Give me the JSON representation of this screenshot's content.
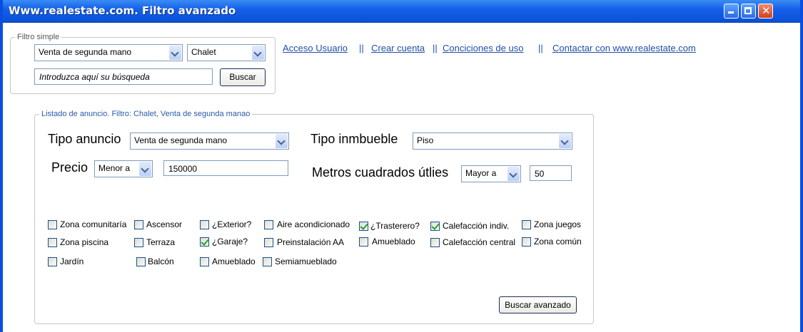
{
  "window": {
    "title": "Www.realestate.com. Filtro avanzado"
  },
  "simple_filter": {
    "legend": "Filtro simple",
    "operation_select": "Venta de segunda mano",
    "property_select": "Chalet",
    "search_placeholder": "Introduzca aquí su búsqueda",
    "search_button": "Buscar"
  },
  "links": {
    "login": "Acceso Usuario",
    "sep1": "||",
    "create_account": "Crear cuenta",
    "sep2": "||",
    "terms": "Conciciones de uso",
    "sep3": "||",
    "contact": "Contactar con www.realestate.com"
  },
  "listing": {
    "legend": "Listado de anuncio. Filtro: Chalet, Venta de segunda manao",
    "tipo_anuncio_label": "Tipo anuncio",
    "tipo_anuncio_value": "Venta de segunda mano",
    "tipo_inmueble_label": "Tipo inmbueble",
    "tipo_inmueble_value": "Piso",
    "precio_label": "Precio",
    "precio_op": "Menor a",
    "precio_value": "150000",
    "metros_label": "Metros cuadrados útlies",
    "metros_op": "Mayor a",
    "metros_value": "50",
    "features": [
      {
        "label": "Zona comunitaría",
        "checked": false
      },
      {
        "label": "Ascensor",
        "checked": false
      },
      {
        "label": "¿Exterior?",
        "checked": false
      },
      {
        "label": "Aire acondicionado",
        "checked": false
      },
      {
        "label": "¿Trasterero?",
        "checked": true
      },
      {
        "label": "Calefacción indiv.",
        "checked": true
      },
      {
        "label": "Zona juegos",
        "checked": false
      },
      {
        "label": "Zona piscina",
        "checked": false
      },
      {
        "label": "Terraza",
        "checked": false
      },
      {
        "label": "¿Garaje?",
        "checked": true
      },
      {
        "label": "Preinstalación AA",
        "checked": false
      },
      {
        "label": "Amueblado",
        "checked": false
      },
      {
        "label": "Calefacción central",
        "checked": false
      },
      {
        "label": "Zona común",
        "checked": false
      },
      {
        "label": "Jardín",
        "checked": false
      },
      {
        "label": "Balcón",
        "checked": false
      },
      {
        "label": "Amueblado",
        "checked": false
      },
      {
        "label": "Semiamueblado",
        "checked": false
      }
    ],
    "search_button": "Buscar avanzado"
  }
}
